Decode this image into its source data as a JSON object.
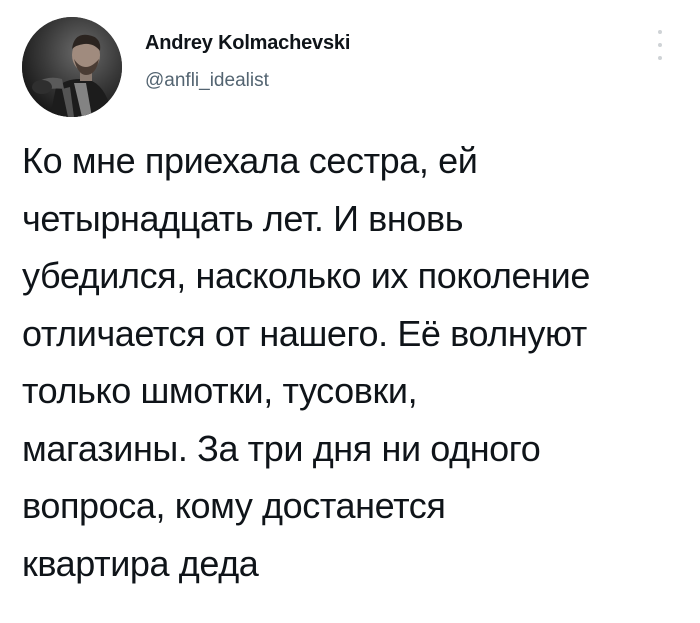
{
  "tweet": {
    "author": {
      "display_name": "Andrey Kolmachevski",
      "handle": "@anfli_idealist",
      "avatar_icon": "user-avatar-photo"
    },
    "menu_icon": "more-vertical-icon",
    "text_lines": [
      "Ко мне приехала сестра, ей",
      "четырнадцать лет. И вновь",
      "убедился, насколько их поколение",
      "отличается от нашего. Её волнуют",
      "только шмотки, тусовки,",
      "магазины. За три дня ни одного",
      "вопроса, кому достанется",
      "квартира деда"
    ]
  }
}
